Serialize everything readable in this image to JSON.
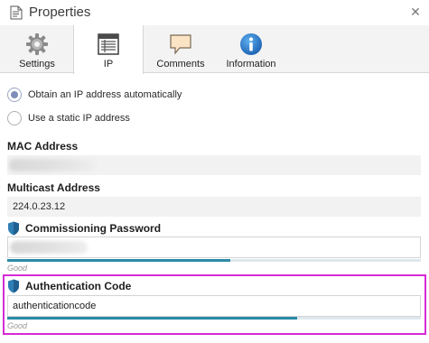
{
  "window": {
    "title": "Properties",
    "title_icon": "properties-doc-icon",
    "close_glyph": "✕"
  },
  "tabs": [
    {
      "label": "Settings",
      "icon": "gear-icon",
      "active": false
    },
    {
      "label": "IP",
      "icon": "ip-table-icon",
      "active": true
    },
    {
      "label": "Comments",
      "icon": "comment-bubble-icon",
      "active": false
    },
    {
      "label": "Information",
      "icon": "info-icon",
      "active": false
    }
  ],
  "ip_mode": {
    "options": [
      {
        "label": "Obtain an IP address automatically",
        "checked": true
      },
      {
        "label": "Use a static IP address",
        "checked": false
      }
    ]
  },
  "mac_address": {
    "label": "MAC Address",
    "value_redacted": true
  },
  "multicast_address": {
    "label": "Multicast Address",
    "value": "224.0.23.12"
  },
  "commissioning_password": {
    "label": "Commissioning Password",
    "icon": "shield-icon",
    "value_redacted": true,
    "strength_text": "Good",
    "strength_fraction": 0.54
  },
  "authentication_code": {
    "label": "Authentication Code",
    "icon": "shield-icon",
    "value": "authenticationcode",
    "strength_text": "Good",
    "strength_fraction": 0.7,
    "highlighted": true
  },
  "colors": {
    "highlight": "#d62ad6",
    "strength_bar": "#2b8aa6",
    "shield": "#2f7fb5",
    "info_blue": "#1a73c8"
  }
}
